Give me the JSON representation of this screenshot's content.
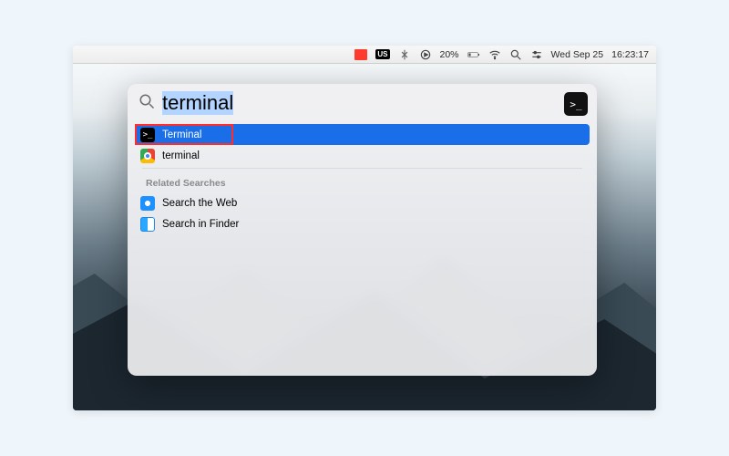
{
  "menubar": {
    "input_label": "US",
    "battery_pct": "20%",
    "date": "Wed Sep 25",
    "time": "16:23:17"
  },
  "spotlight": {
    "query": "terminal",
    "top_hit_preview_icon": "terminal-icon",
    "results": [
      {
        "icon": "terminal-icon",
        "label": "Terminal",
        "selected": true
      },
      {
        "icon": "chrome-icon",
        "label": "terminal",
        "selected": false
      }
    ],
    "related_header": "Related Searches",
    "related": [
      {
        "icon": "safari-icon",
        "label": "Search the Web"
      },
      {
        "icon": "finder-icon",
        "label": "Search in Finder"
      }
    ]
  }
}
